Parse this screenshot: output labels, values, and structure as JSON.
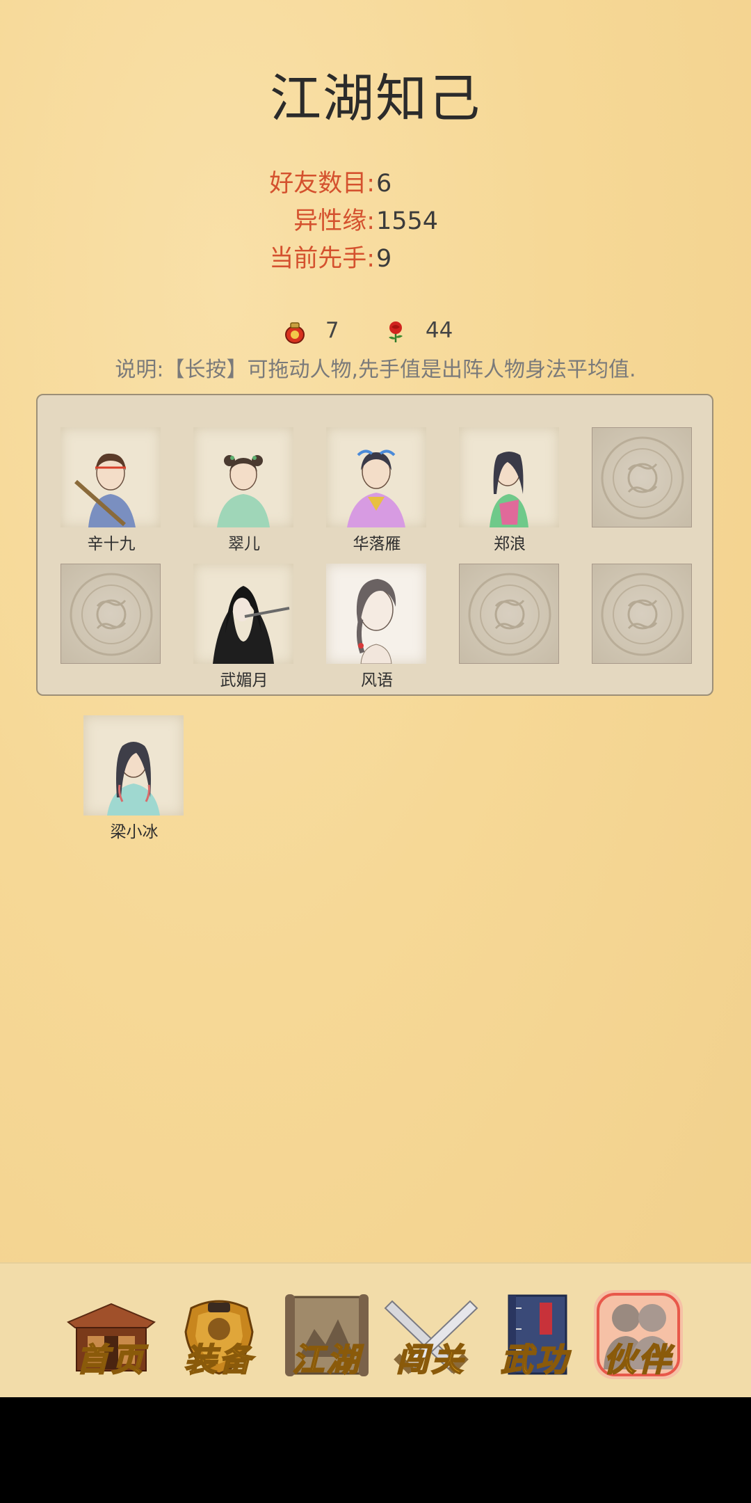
{
  "page": {
    "title": "江湖知己"
  },
  "stats": [
    {
      "label": "好友数目:",
      "value": "6"
    },
    {
      "label": "异性缘:",
      "value": "1554"
    },
    {
      "label": "当前先手:",
      "value": "9"
    }
  ],
  "resources": {
    "wine": {
      "icon": "wine-jar-icon",
      "count": "7"
    },
    "rose": {
      "icon": "rose-icon",
      "count": "44"
    }
  },
  "note": "说明:【长按】可拖动人物,先手值是出阵人物身法平均值.",
  "lineup": [
    {
      "name": "辛十九",
      "filled": true
    },
    {
      "name": "翠儿",
      "filled": true
    },
    {
      "name": "华落雁",
      "filled": true
    },
    {
      "name": "郑浪",
      "filled": true
    },
    {
      "name": "",
      "filled": false
    },
    {
      "name": "",
      "filled": false
    },
    {
      "name": "武媚月",
      "filled": true
    },
    {
      "name": "风语",
      "filled": true
    },
    {
      "name": "",
      "filled": false
    },
    {
      "name": "",
      "filled": false
    }
  ],
  "reserve": [
    {
      "name": "梁小冰"
    }
  ],
  "tabs": [
    {
      "label": "首页",
      "icon": "house-icon",
      "active": false
    },
    {
      "label": "装备",
      "icon": "armor-icon",
      "active": false
    },
    {
      "label": "江湖",
      "icon": "scroll-map-icon",
      "active": false
    },
    {
      "label": "闯关",
      "icon": "crossed-swords-icon",
      "active": false
    },
    {
      "label": "武功",
      "icon": "book-icon",
      "active": false
    },
    {
      "label": "伙伴",
      "icon": "companions-icon",
      "active": true
    }
  ],
  "colors": {
    "label_red": "#d4512e",
    "gold": "#efb21c",
    "active_glow": "#e8584a"
  }
}
